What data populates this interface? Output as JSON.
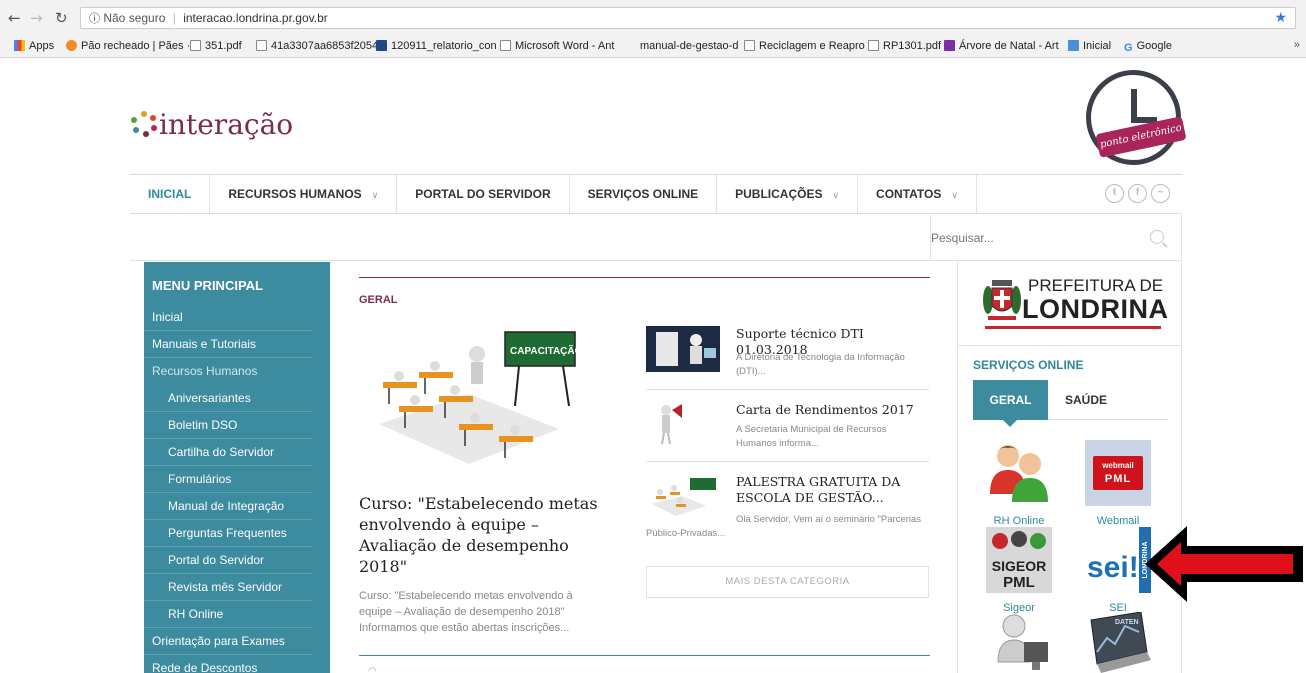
{
  "browser": {
    "security_label": "Não seguro",
    "url": "interacao.londrina.pr.gov.br",
    "bookmarks": [
      {
        "label": "Apps",
        "icon": "apps-icon"
      },
      {
        "label": "Pão recheado | Pães ·",
        "icon": "site-icon"
      },
      {
        "label": "351.pdf",
        "icon": "document-icon"
      },
      {
        "label": "41a3307aa6853f2054",
        "icon": "document-icon"
      },
      {
        "label": "120911_relatorio_con",
        "icon": "ipea-icon"
      },
      {
        "label": "Microsoft Word - Ant",
        "icon": "document-icon"
      },
      {
        "label": "manual-de-gestao-d",
        "icon": ""
      },
      {
        "label": "Reciclagem e Reapro",
        "icon": "document-icon"
      },
      {
        "label": "RP1301.pdf",
        "icon": "document-icon"
      },
      {
        "label": "Árvore de Natal - Art",
        "icon": "site-icon"
      },
      {
        "label": "Inicial",
        "icon": "site-icon"
      },
      {
        "label": "Google",
        "icon": "google-icon"
      }
    ],
    "more_label": "»"
  },
  "site": {
    "logo_text": "interação",
    "clock_badge": "ponto eletrônico",
    "nav": [
      {
        "label": "INICIAL",
        "has_dropdown": false,
        "active": true
      },
      {
        "label": "RECURSOS HUMANOS",
        "has_dropdown": true,
        "active": false
      },
      {
        "label": "PORTAL DO SERVIDOR",
        "has_dropdown": false,
        "active": false
      },
      {
        "label": "SERVIÇOS ONLINE",
        "has_dropdown": false,
        "active": false
      },
      {
        "label": "PUBLICAÇÕES",
        "has_dropdown": true,
        "active": false
      },
      {
        "label": "CONTATOS",
        "has_dropdown": true,
        "active": false
      }
    ],
    "search_placeholder": "Pesquisar..."
  },
  "sidebar": {
    "title": "MENU PRINCIPAL",
    "items": [
      {
        "label": "Inicial",
        "sub": false,
        "muted": false
      },
      {
        "label": "Manuais e Tutoriais",
        "sub": false,
        "muted": false
      },
      {
        "label": "Recursos Humanos",
        "sub": false,
        "muted": true
      },
      {
        "label": "Aniversariantes",
        "sub": true,
        "muted": false
      },
      {
        "label": "Boletim DSO",
        "sub": true,
        "muted": false
      },
      {
        "label": "Cartilha do Servidor",
        "sub": true,
        "muted": false
      },
      {
        "label": "Formulários",
        "sub": true,
        "muted": false
      },
      {
        "label": "Manual de Integração",
        "sub": true,
        "muted": false
      },
      {
        "label": "Perguntas Frequentes",
        "sub": true,
        "muted": false
      },
      {
        "label": "Portal do Servidor",
        "sub": true,
        "muted": false
      },
      {
        "label": "Revista mês Servidor",
        "sub": true,
        "muted": false
      },
      {
        "label": "RH Online",
        "sub": true,
        "muted": false
      },
      {
        "label": "Orientação para Exames",
        "sub": false,
        "muted": false
      },
      {
        "label": "Rede de Descontos",
        "sub": false,
        "muted": false
      }
    ]
  },
  "main": {
    "section": "GERAL",
    "featured": {
      "image_label": "CAPACITAÇÃO",
      "title": "Curso: \"Estabelecendo metas envolvendo à equipe – Avaliação de desempenho 2018\"",
      "excerpt": "Curso: \"Estabelecendo metas envolvendo à equipe – Avaliação de desempenho 2018\" Informamos que estão abertas inscrições..."
    },
    "news": [
      {
        "title": "Suporte técnico DTI 01.03.2018",
        "excerpt": "A Diretoria de Tecnologia da Informação (DTI)..."
      },
      {
        "title": "Carta de Rendimentos 2017",
        "excerpt": "A Secretaria Municipal de Recursos Humanos informa..."
      },
      {
        "title": "PALESTRA GRATUITA DA ESCOLA DE GESTÃO...",
        "excerpt": "Olá Servidor, Vem aí o seminário \"Parcerias Público-Privadas..."
      }
    ],
    "more_label": "MAIS DESTA CATEGORIA"
  },
  "right": {
    "pref_line1": "PREFEITURA DE",
    "pref_line2": "LONDRINA",
    "services_title": "SERVIÇOS ONLINE",
    "tabs": [
      "GERAL",
      "SAÚDE"
    ],
    "services": [
      {
        "label": "RH Online",
        "icon": "rh-online-icon"
      },
      {
        "label": "Webmail",
        "icon": "webmail-icon",
        "badge_top": "webmail",
        "badge_bottom": "PML"
      },
      {
        "label": "Sigeor",
        "icon": "sigeor-icon",
        "badge_top": "SIGEOR",
        "badge_bottom": "PML"
      },
      {
        "label": "SEI",
        "icon": "sei-icon",
        "badge_top": "sei!",
        "badge_bottom": "LONDRINA"
      },
      {
        "label": "",
        "icon": "computer-user-icon"
      },
      {
        "label": "",
        "icon": "dataprev-icon",
        "badge_top": "DATEN"
      }
    ]
  },
  "colors": {
    "teal": "#3c8b9e",
    "wine": "#7a2b50",
    "arrow_red": "#e0101b"
  }
}
